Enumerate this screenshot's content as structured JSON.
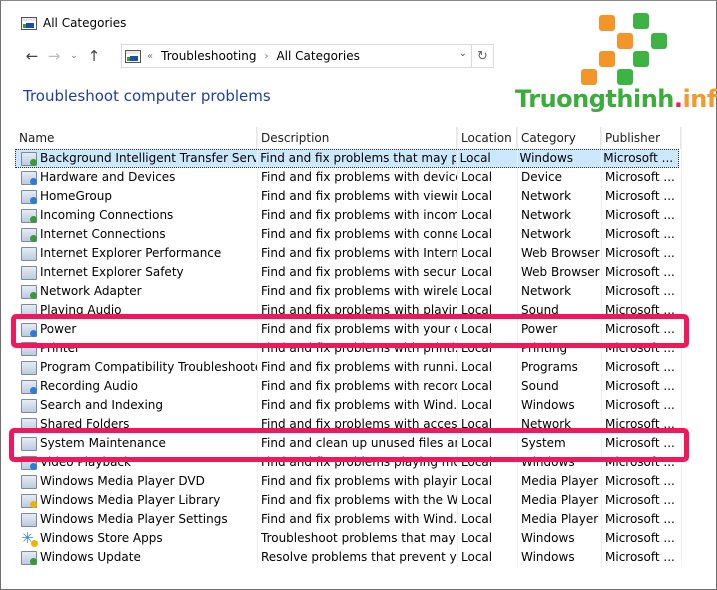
{
  "window": {
    "title": "All Categories",
    "title_icon": "control-panel-icon"
  },
  "nav": {
    "back_icon": "←",
    "forward_icon": "→",
    "recent_icon": "⌄",
    "up_icon": "↑"
  },
  "address": {
    "overflow": "«",
    "crumbs": [
      "Troubleshooting",
      "All Categories"
    ],
    "separator": "›",
    "dropdown_icon": "⌄",
    "refresh_icon": "↻"
  },
  "heading": "Troubleshoot computer problems",
  "watermark": {
    "brand": "Truongthinh",
    "dot": ".",
    "tld": "info",
    "colors": {
      "green": "#3db343",
      "orange": "#f4952a",
      "dot": "#e8204f"
    }
  },
  "table": {
    "columns": [
      "Name",
      "Description",
      "Location",
      "Category",
      "Publisher"
    ],
    "rows": [
      {
        "name": "Background Intelligent Transfer Service",
        "description": "Find and fix problems that may p...",
        "location": "Local",
        "category": "Windows",
        "publisher": "Microsoft ...",
        "icon": "bits-icon",
        "selected": true
      },
      {
        "name": "Hardware and Devices",
        "description": "Find and fix problems with device...",
        "location": "Local",
        "category": "Device",
        "publisher": "Microsoft ...",
        "icon": "hardware-icon"
      },
      {
        "name": "HomeGroup",
        "description": "Find and fix problems with viewin...",
        "location": "Local",
        "category": "Network",
        "publisher": "Microsoft ...",
        "icon": "homegroup-icon"
      },
      {
        "name": "Incoming Connections",
        "description": "Find and fix problems with incom...",
        "location": "Local",
        "category": "Network",
        "publisher": "Microsoft ...",
        "icon": "incoming-connections-icon"
      },
      {
        "name": "Internet Connections",
        "description": "Find and fix problems with conne...",
        "location": "Local",
        "category": "Network",
        "publisher": "Microsoft ...",
        "icon": "internet-connections-icon"
      },
      {
        "name": "Internet Explorer Performance",
        "description": "Find and fix problems with Intern...",
        "location": "Local",
        "category": "Web Browser",
        "publisher": "Microsoft ...",
        "icon": "ie-performance-icon"
      },
      {
        "name": "Internet Explorer Safety",
        "description": "Find and fix problems with securi...",
        "location": "Local",
        "category": "Web Browser",
        "publisher": "Microsoft ...",
        "icon": "ie-safety-icon"
      },
      {
        "name": "Network Adapter",
        "description": "Find and fix problems with wirele...",
        "location": "Local",
        "category": "Network",
        "publisher": "Microsoft ...",
        "icon": "network-adapter-icon"
      },
      {
        "name": "Playing Audio",
        "description": "Find and fix problems with playin...",
        "location": "Local",
        "category": "Sound",
        "publisher": "Microsoft ...",
        "icon": "playing-audio-icon",
        "partially_hidden": true
      },
      {
        "name": "Power",
        "description": "Find and fix problems with your c...",
        "location": "Local",
        "category": "Power",
        "publisher": "Microsoft ...",
        "icon": "power-icon",
        "highlighted": true
      },
      {
        "name": "Printer",
        "description": "Find and fix problems with printi...",
        "location": "Local",
        "category": "Printing",
        "publisher": "Microsoft ...",
        "icon": "printer-icon",
        "partially_hidden": true
      },
      {
        "name": "Program Compatibility Troubleshooter",
        "description": "Find and fix problems with runni...",
        "location": "Local",
        "category": "Programs",
        "publisher": "Microsoft ...",
        "icon": "program-compatibility-icon"
      },
      {
        "name": "Recording Audio",
        "description": "Find and fix problems with record...",
        "location": "Local",
        "category": "Sound",
        "publisher": "Microsoft ...",
        "icon": "recording-audio-icon"
      },
      {
        "name": "Search and Indexing",
        "description": "Find and fix problems with Wind...",
        "location": "Local",
        "category": "Windows",
        "publisher": "Microsoft ...",
        "icon": "search-indexing-icon"
      },
      {
        "name": "Shared Folders",
        "description": "Find and fix problems with acces...",
        "location": "Local",
        "category": "Network",
        "publisher": "Microsoft ...",
        "icon": "shared-folders-icon",
        "partially_hidden": true
      },
      {
        "name": "System Maintenance",
        "description": "Find and clean up unused files an...",
        "location": "Local",
        "category": "System",
        "publisher": "Microsoft ...",
        "icon": "system-maintenance-icon",
        "highlighted": true
      },
      {
        "name": "Video Playback",
        "description": "Find and fix problems playing mo...",
        "location": "Local",
        "category": "Windows",
        "publisher": "Microsoft ...",
        "icon": "video-playback-icon",
        "partially_hidden": true
      },
      {
        "name": "Windows Media Player DVD",
        "description": "Find and fix problems with playin...",
        "location": "Local",
        "category": "Media Player",
        "publisher": "Microsoft ...",
        "icon": "wmp-dvd-icon"
      },
      {
        "name": "Windows Media Player Library",
        "description": "Find and fix problems with the Wi...",
        "location": "Local",
        "category": "Media Player",
        "publisher": "Microsoft ...",
        "icon": "wmp-library-icon"
      },
      {
        "name": "Windows Media Player Settings",
        "description": "Find and fix problems with Wind...",
        "location": "Local",
        "category": "Media Player",
        "publisher": "Microsoft ...",
        "icon": "wmp-settings-icon"
      },
      {
        "name": "Windows Store Apps",
        "description": "Troubleshoot problems that may ...",
        "location": "Local",
        "category": "Windows",
        "publisher": "Microsoft ...",
        "icon": "windows-store-icon"
      },
      {
        "name": "Windows Update",
        "description": "Resolve problems that prevent yo...",
        "location": "Local",
        "category": "Windows",
        "publisher": "Microsoft ...",
        "icon": "windows-update-icon"
      }
    ]
  },
  "highlight_color": "#f0175a",
  "selection_color": "#cce8ff"
}
